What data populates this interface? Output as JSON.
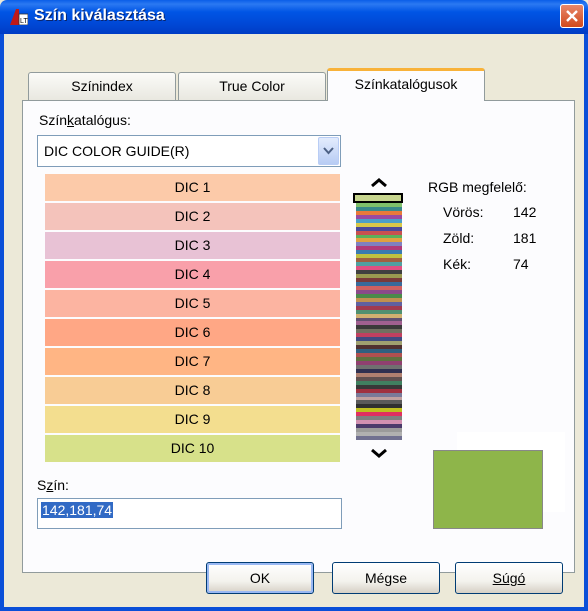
{
  "window": {
    "title": "Szín kiválasztása"
  },
  "tabs": [
    {
      "label": "Színindex",
      "active": false
    },
    {
      "label": "True Color",
      "active": false
    },
    {
      "label": "Színkatalógusok",
      "active": true
    }
  ],
  "catalog": {
    "label_pre": "Szín",
    "label_mnemonic": "k",
    "label_post": "atalógus:",
    "selected": "DIC COLOR GUIDE(R)"
  },
  "swatches": [
    {
      "label": "DIC 1",
      "color": "#fccaa9"
    },
    {
      "label": "DIC 2",
      "color": "#f4c3bb"
    },
    {
      "label": "DIC 3",
      "color": "#e8c2d5"
    },
    {
      "label": "DIC 4",
      "color": "#f9a0aa"
    },
    {
      "label": "DIC 5",
      "color": "#fcb4a1"
    },
    {
      "label": "DIC 6",
      "color": "#ffa785"
    },
    {
      "label": "DIC 7",
      "color": "#ffb584"
    },
    {
      "label": "DIC 8",
      "color": "#f8cc95"
    },
    {
      "label": "DIC 9",
      "color": "#f3de8f"
    },
    {
      "label": "DIC 10",
      "color": "#d7e18a"
    }
  ],
  "colorbar": [
    "#cc6b8f",
    "#c43a5a",
    "#7fc06a",
    "#3a8a8a",
    "#e87a3a",
    "#9a4aa0",
    "#4aa0c8",
    "#d8c848",
    "#4a4a9a",
    "#c85050",
    "#5ab05a",
    "#e0a040",
    "#8080c0",
    "#b03a7a",
    "#3a7ab0",
    "#c0c040",
    "#a06040",
    "#50a0a0",
    "#e05080",
    "#404040",
    "#9a9a50",
    "#7a3a3a",
    "#3a6a9a",
    "#d06060",
    "#8a4a8a",
    "#4a8a4a",
    "#c09050",
    "#6060a0",
    "#a03a50",
    "#509070",
    "#d0b070",
    "#605070",
    "#a06090",
    "#3a3a3a",
    "#707060",
    "#c04060",
    "#404a80",
    "#a0a070",
    "#503030",
    "#306080",
    "#b05050",
    "#607040",
    "#904070",
    "#707070",
    "#303050",
    "#b08070",
    "#605050",
    "#408060",
    "#383838",
    "#a03040",
    "#7a7a9a",
    "#c0a0a0",
    "#5a5a5a",
    "#303030",
    "#c0c020",
    "#e03060",
    "#808080",
    "#d090b0",
    "#4a3a6a",
    "#9a9a9a",
    "#b0b0b0",
    "#707090"
  ],
  "rgb": {
    "title": "RGB megfelelő:",
    "red_label": "Vörös:",
    "red": "142",
    "green_label": "Zöld:",
    "green": "181",
    "blue_label": "Kék:",
    "blue": "74",
    "preview_color": "#8eb54a"
  },
  "color_field": {
    "label_mnemonic": "z",
    "label_pre": "S",
    "label_post": "ín:",
    "value": "142,181,74"
  },
  "buttons": {
    "ok": "OK",
    "cancel": "Mégse",
    "help": "Súgó"
  }
}
